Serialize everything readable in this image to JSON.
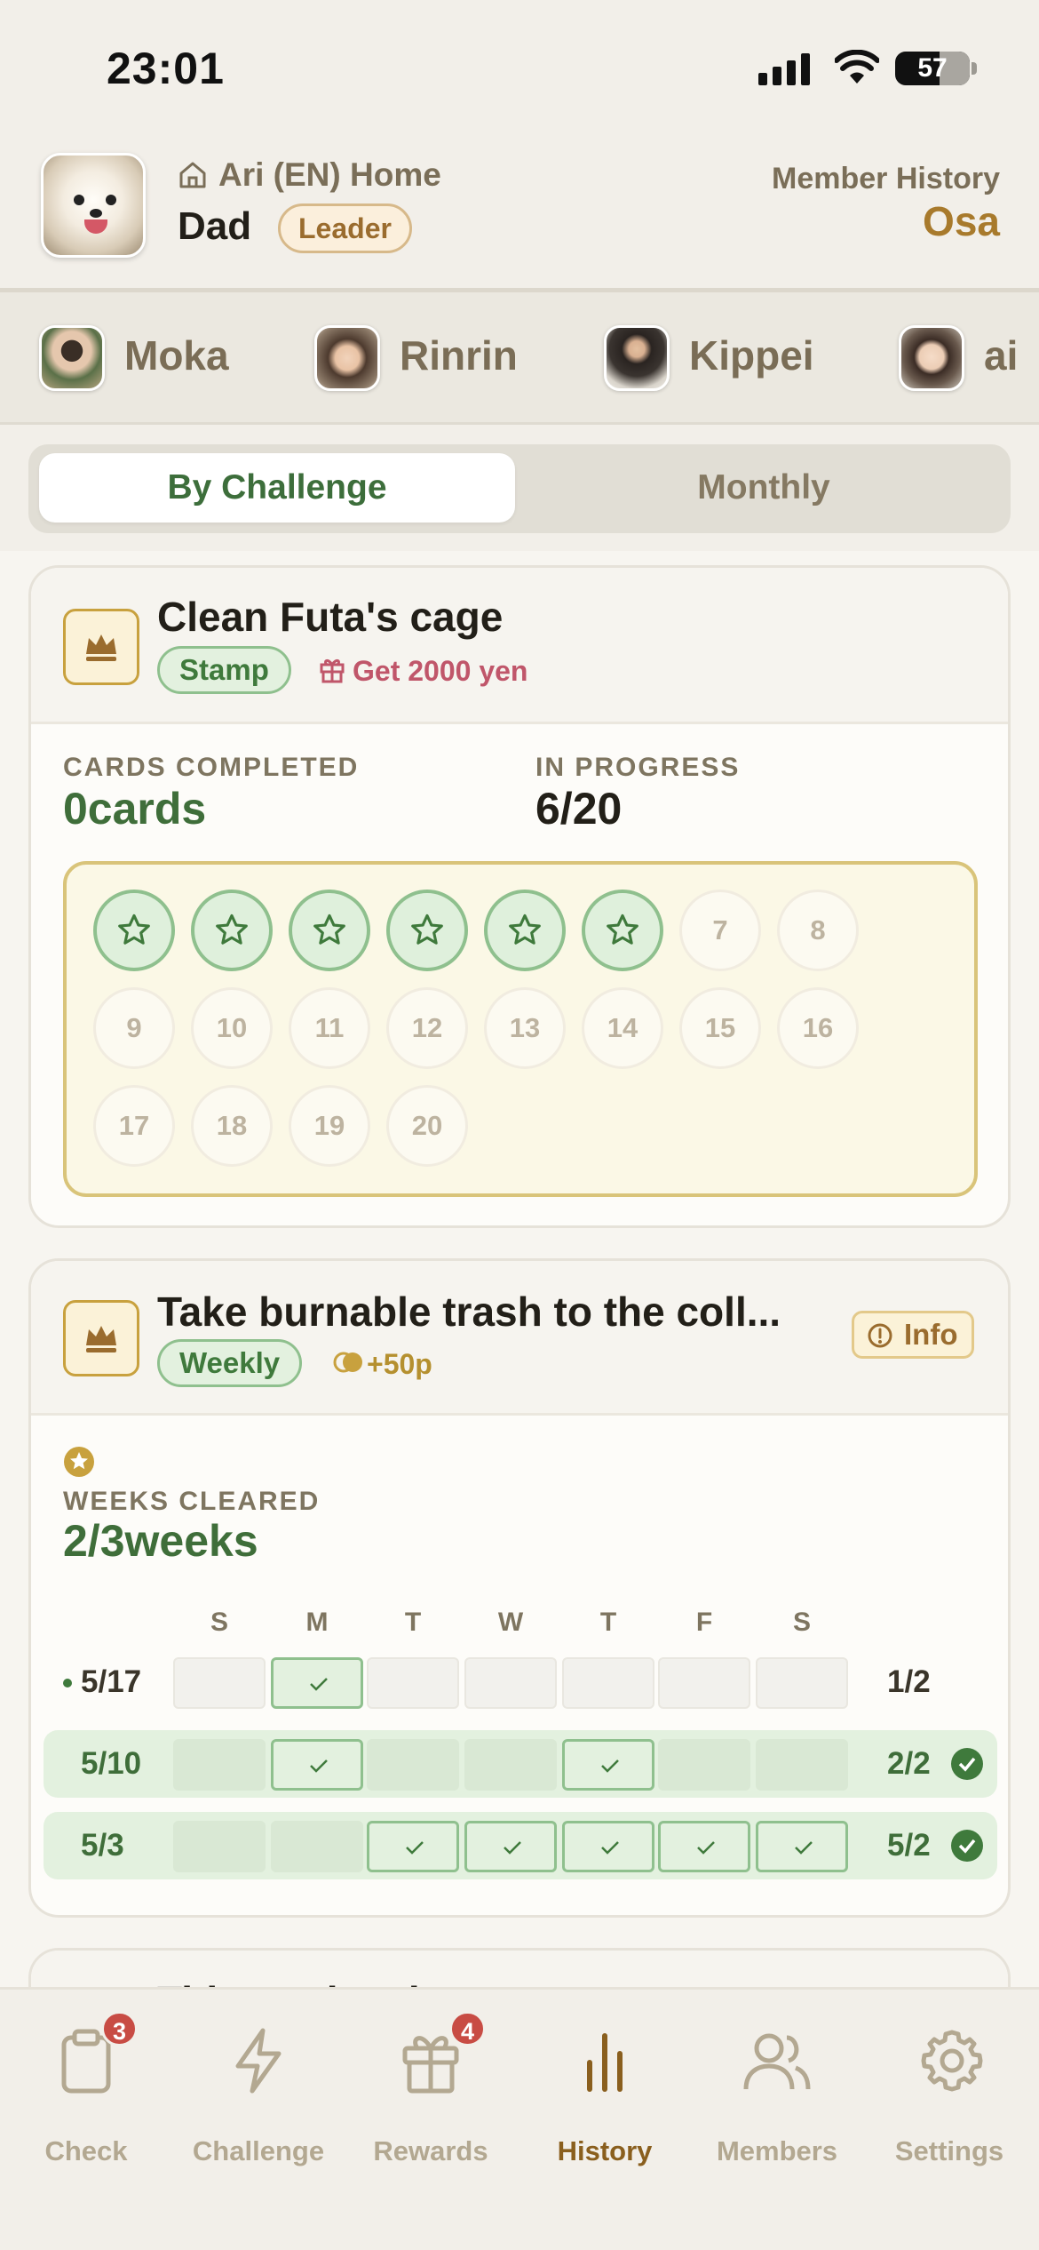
{
  "status_bar": {
    "time": "23:01",
    "battery": "57"
  },
  "header": {
    "home_label": "Ari (EN) Home",
    "user_name": "Dad",
    "role_badge": "Leader",
    "member_history_label": "Member History",
    "member_history_name": "Osa"
  },
  "members": [
    {
      "name": "Moka"
    },
    {
      "name": "Rinrin"
    },
    {
      "name": "Kippei"
    },
    {
      "name": "ai"
    }
  ],
  "segmented": {
    "tab1": "By Challenge",
    "tab2": "Monthly",
    "selected": "By Challenge"
  },
  "cards": [
    {
      "title": "Clean Futa's cage",
      "tag": "Stamp",
      "reward": "Get 2000 yen",
      "stat1_label": "CARDS COMPLETED",
      "stat1_value": "0cards",
      "stat2_label": "IN PROGRESS",
      "stat2_value": "6/20",
      "stamps_total": 20,
      "stamps_done": 6,
      "stamp_numbers": [
        "7",
        "8",
        "9",
        "10",
        "11",
        "12",
        "13",
        "14",
        "15",
        "16",
        "17",
        "18",
        "19",
        "20"
      ]
    },
    {
      "title": "Take burnable trash to the coll...",
      "tag": "Weekly",
      "reward": "+50p",
      "info_label": "Info",
      "stat_label": "WEEKS CLEARED",
      "stat_value": "2/3weeks",
      "days": [
        "S",
        "M",
        "T",
        "W",
        "T",
        "F",
        "S"
      ],
      "weeks": [
        {
          "date": "5/17",
          "count": "1/2",
          "checked": [
            1
          ],
          "cleared": false,
          "current": true
        },
        {
          "date": "5/10",
          "count": "2/2",
          "checked": [
            1,
            4
          ],
          "cleared": true,
          "current": false
        },
        {
          "date": "5/3",
          "count": "5/2",
          "checked": [
            2,
            3,
            4,
            5,
            6
          ],
          "cleared": true,
          "current": false
        }
      ]
    },
    {
      "title": "Tidy up the shoes"
    }
  ],
  "tabs": [
    {
      "label": "Check",
      "icon": "clipboard-icon",
      "badge": "3"
    },
    {
      "label": "Challenge",
      "icon": "lightning-icon",
      "badge": ""
    },
    {
      "label": "Rewards",
      "icon": "gift-icon",
      "badge": "4"
    },
    {
      "label": "History",
      "icon": "chart-icon",
      "badge": "",
      "active": true
    },
    {
      "label": "Members",
      "icon": "members-icon",
      "badge": ""
    },
    {
      "label": "Settings",
      "icon": "gear-icon",
      "badge": ""
    }
  ],
  "colors": {
    "accent_green": "#3f7a3c",
    "accent_brown": "#8a5f1e",
    "badge_red": "#c84c44",
    "gold": "#c8a13e"
  }
}
